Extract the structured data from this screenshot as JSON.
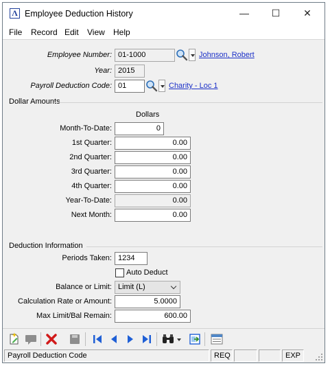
{
  "window": {
    "title": "Employee Deduction History",
    "controls": {
      "minimize": "—",
      "maximize": "☐",
      "close": "✕"
    }
  },
  "menu": [
    "File",
    "Record",
    "Edit",
    "View",
    "Help"
  ],
  "header_fields": {
    "employee_number": {
      "label": "Employee Number:",
      "value": "01-1000",
      "link": "Johnson, Robert"
    },
    "year": {
      "label": "Year:",
      "value": "2015"
    },
    "payroll_deduction_code": {
      "label": "Payroll Deduction Code:",
      "value": "01",
      "link": "Charity - Loc 1"
    }
  },
  "dollar_amounts": {
    "section_title": "Dollar Amounts",
    "column_header": "Dollars",
    "rows": [
      {
        "label": "Month-To-Date:",
        "value": "0"
      },
      {
        "label": "1st Quarter:",
        "value": "0.00"
      },
      {
        "label": "2nd Quarter:",
        "value": "0.00"
      },
      {
        "label": "3rd Quarter:",
        "value": "0.00"
      },
      {
        "label": "4th Quarter:",
        "value": "0.00"
      },
      {
        "label": "Year-To-Date:",
        "value": "0.00"
      },
      {
        "label": "Next Month:",
        "value": "0.00"
      }
    ]
  },
  "deduction_info": {
    "section_title": "Deduction Information",
    "periods_taken": {
      "label": "Periods Taken:",
      "value": "1234"
    },
    "auto_deduct": {
      "label": "Auto Deduct",
      "checked": false
    },
    "balance_or_limit": {
      "label": "Balance or Limit:",
      "value": "Limit (L)"
    },
    "calculation_rate": {
      "label": "Calculation Rate or Amount:",
      "value": "5.0000"
    },
    "max_limit": {
      "label": "Max Limit/Bal Remain:",
      "value": "600.00"
    }
  },
  "toolbar": {
    "icons": [
      "new-record-icon",
      "comment-icon",
      "delete-icon",
      "save-icon",
      "first-record-icon",
      "previous-record-icon",
      "next-record-icon",
      "last-record-icon",
      "find-icon",
      "find-dropdown-icon",
      "export-icon",
      "list-view-icon"
    ]
  },
  "statusbar": {
    "message": "Payroll Deduction Code",
    "req": "REQ",
    "exp": "EXP"
  },
  "colors": {
    "link": "#1a2fc7",
    "delete": "#d11a1a",
    "nav": "#1f5fd6"
  }
}
